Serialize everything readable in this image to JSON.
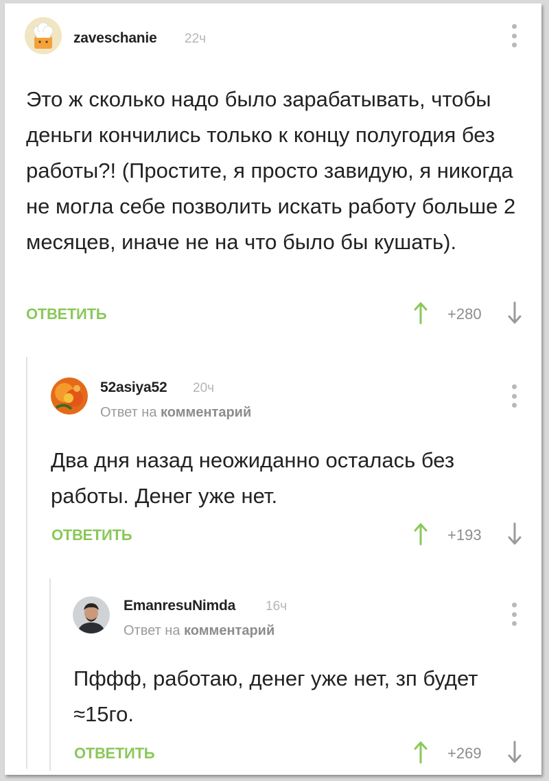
{
  "comments": [
    {
      "username": "zaveschanie",
      "time": "22ч",
      "text": "Это ж сколько надо было зарабатывать, чтобы деньги кончились только к концу полугодия без работы?! (Простите, я просто завидую, я никогда не могла себе позволить искать работу больше 2 месяцев, иначе не на что было бы кушать).",
      "reply_label": "ОТВЕТИТЬ",
      "score": "+280",
      "avatar_icon": "chef-hat-avatar-icon"
    },
    {
      "username": "52asiya52",
      "time": "20ч",
      "reply_prefix": "Ответ на",
      "reply_target": "комментарий",
      "text": "Два дня назад неожиданно осталась без работы. Денег уже нет.",
      "reply_label": "ОТВЕТИТЬ",
      "score": "+193",
      "avatar_icon": "orange-flower-avatar-icon"
    },
    {
      "username": "EmanresuNimda",
      "time": "16ч",
      "reply_prefix": "Ответ на",
      "reply_target": "комментарий",
      "text": "Пффф, работаю, денег уже нет, зп будет ≈15го.",
      "reply_label": "ОТВЕТИТЬ",
      "score": "+269",
      "avatar_icon": "man-portrait-avatar-icon"
    }
  ],
  "colors": {
    "accent_green": "#8ac858",
    "vote_up": "#8ac858",
    "vote_down": "#9a9a9a",
    "muted_text": "#9a9a9a"
  }
}
